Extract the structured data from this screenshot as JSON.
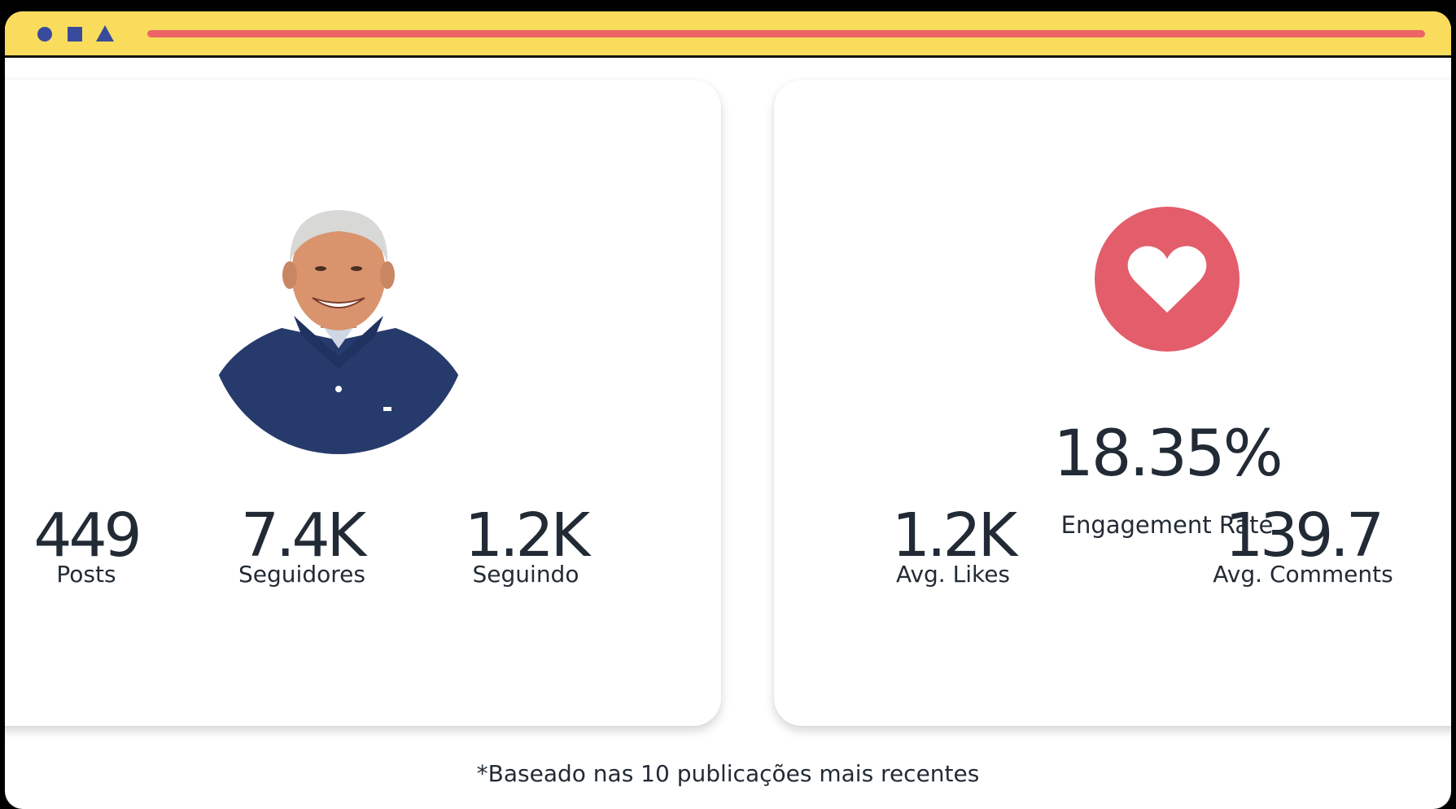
{
  "window_controls": [
    "circle-icon",
    "square-icon",
    "triangle-icon"
  ],
  "colors": {
    "titlebar": "#f9dc5c",
    "address_bar": "#ec6466",
    "controls": "#3a4a9c",
    "heart_badge": "#e35d6a",
    "text": "#222b35"
  },
  "profile": {
    "avatar_icon": "profile-photo",
    "stats": [
      {
        "value": "449",
        "label": "Posts"
      },
      {
        "value": "7.4K",
        "label": "Seguidores"
      },
      {
        "value": "1.2K",
        "label": "Seguindo"
      }
    ]
  },
  "engagement": {
    "icon": "heart-icon",
    "rate_value": "18.35%",
    "rate_label": "Engagement Rate",
    "stats": [
      {
        "value": "1.2K",
        "label": "Avg. Likes"
      },
      {
        "value": "139.7",
        "label": "Avg. Comments"
      }
    ]
  },
  "footnote": "*Baseado nas 10 publicações mais recentes"
}
